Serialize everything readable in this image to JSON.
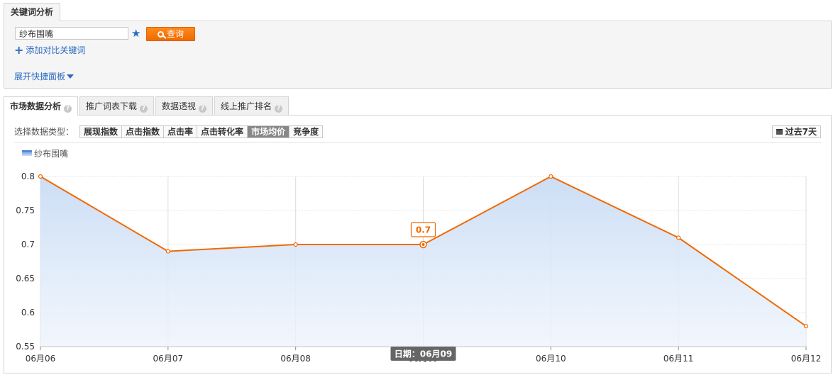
{
  "header_tab": {
    "label": "关键词分析"
  },
  "query": {
    "keyword_value": "纱布围嘴",
    "query_button": "查询",
    "add_compare": "添加对比关键词",
    "expand_panel": "展开快捷面板"
  },
  "tabs": [
    {
      "label": "市场数据分析",
      "active": true
    },
    {
      "label": "推广词表下载",
      "active": false
    },
    {
      "label": "数据透视",
      "active": false
    },
    {
      "label": "线上推广排名",
      "active": false
    }
  ],
  "data_type": {
    "label": "选择数据类型：",
    "options": [
      "展现指数",
      "点击指数",
      "点击率",
      "点击转化率",
      "市场均价",
      "竞争度"
    ],
    "selected": "市场均价"
  },
  "range_button": "过去7天",
  "colors": {
    "accent": "#f06a00",
    "link": "#2a6ac2",
    "area_top": "#c9dcf5",
    "line": "#f06a00"
  },
  "chart_data": {
    "type": "area",
    "legend": [
      "纱布围嘴"
    ],
    "categories": [
      "06月06",
      "06月07",
      "06月08",
      "06月09",
      "06月10",
      "06月11",
      "06月12"
    ],
    "series": [
      {
        "name": "纱布围嘴",
        "values": [
          0.8,
          0.69,
          0.7,
          0.7,
          0.8,
          0.71,
          0.58
        ]
      }
    ],
    "ylim": [
      0.55,
      0.8
    ],
    "yticks": [
      "0.8",
      "0.75",
      "0.7",
      "0.65",
      "0.6",
      "0.55"
    ],
    "grid": true,
    "tooltip": {
      "index": 3,
      "value_label": "0.7",
      "date_label": "日期：06月09"
    }
  }
}
